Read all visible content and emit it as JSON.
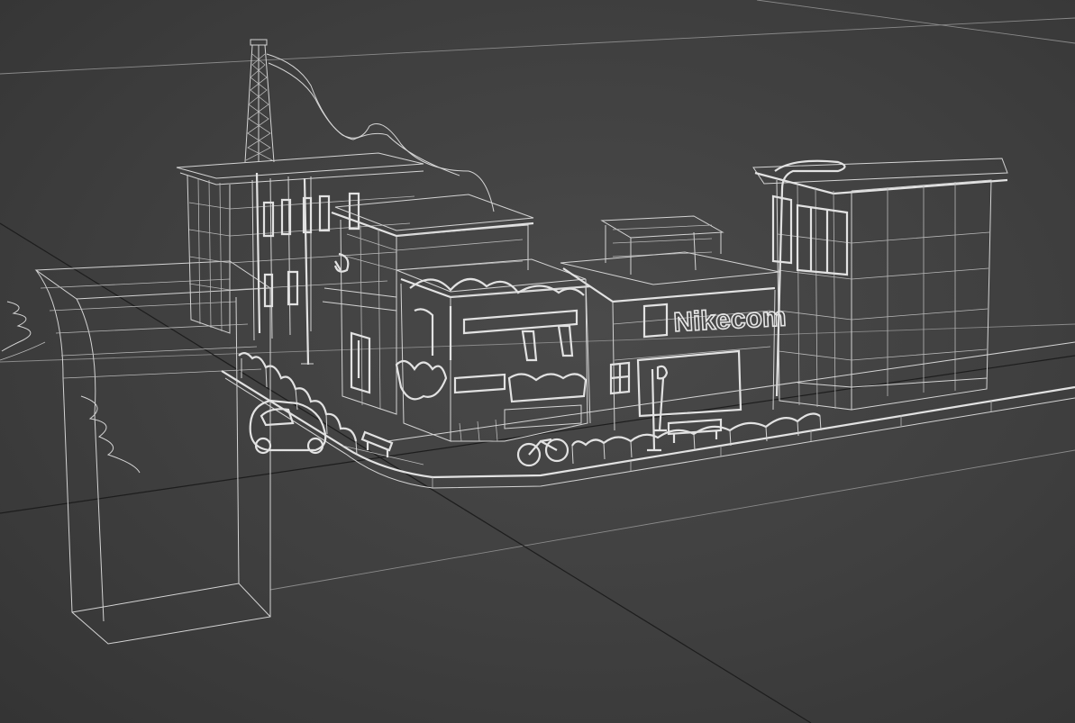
{
  "viewport": {
    "background_color": "#404040",
    "wire_color": "#d4d4d4",
    "grid_major_color": "#1d1d1d",
    "grid_minor_color": "#8a8a8a"
  },
  "scene": {
    "store_sign_text": "Nikecom"
  }
}
